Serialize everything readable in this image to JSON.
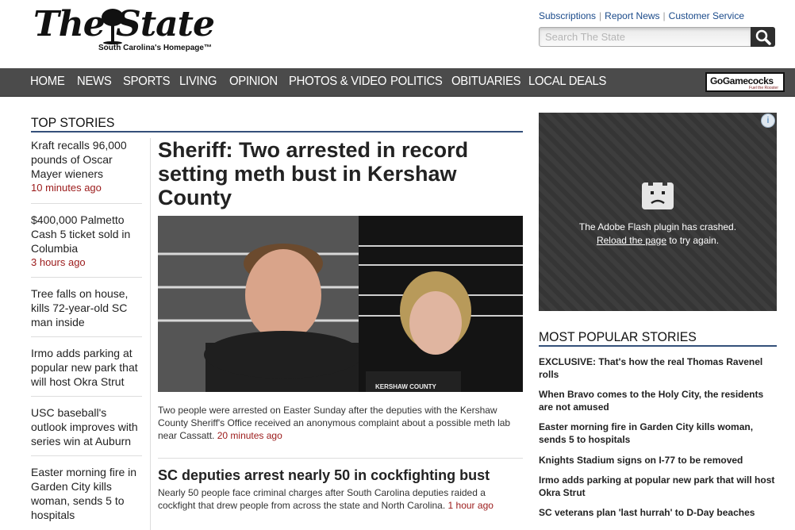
{
  "header": {
    "logo_text": "The State",
    "tagline": "South Carolina's Homepage™",
    "links": [
      "Subscriptions",
      "Report News",
      "Customer Service"
    ],
    "search_placeholder": "Search The State"
  },
  "nav": {
    "items": [
      "HOME",
      "NEWS",
      "SPORTS",
      "LIVING",
      "OPINION",
      "PHOTOS & VIDEO",
      "POLITICS",
      "OBITUARIES",
      "LOCAL DEALS"
    ],
    "promo": "GoGamecocks",
    "promo_sub": "Fuel the Rooster"
  },
  "top_stories": {
    "title": "TOP STORIES",
    "items": [
      {
        "title": "Kraft recalls 96,000 pounds of Oscar Mayer wieners",
        "time": "10 minutes ago"
      },
      {
        "title": "$400,000 Palmetto Cash 5 ticket sold in Columbia",
        "time": "3 hours ago"
      },
      {
        "title": "Tree falls on house, kills 72-year-old SC man inside",
        "time": ""
      },
      {
        "title": "Irmo adds parking at popular new park that will host Okra Strut",
        "time": ""
      },
      {
        "title": "USC baseball's outlook improves with series win at Auburn",
        "time": ""
      },
      {
        "title": "Easter morning fire in Garden City kills woman, sends 5 to hospitals",
        "time": ""
      }
    ]
  },
  "main": {
    "headline": "Sheriff: Two arrested in record setting meth bust in Kershaw County",
    "photo_caption": "KERSHAW COUNTY",
    "summary": "Two people were arrested on Easter Sunday after the deputies with the Kershaw County Sheriff's Office received an anonymous complaint about a possible meth lab near Cassatt.",
    "summary_time": "20 minutes ago",
    "headline2": "SC deputies arrest nearly 50 in cockfighting bust",
    "summary2": "Nearly 50 people face criminal charges after South Carolina deputies raided a cockfight that drew people from across the state and North Carolina.",
    "summary2_time": "1 hour ago"
  },
  "ad": {
    "badge": "i",
    "message": "The Adobe Flash plugin has crashed.",
    "reload_link": "Reload the page",
    "reload_suffix": " to try again."
  },
  "most_popular": {
    "title": "MOST POPULAR STORIES",
    "items": [
      "EXCLUSIVE: That's how the real Thomas Ravenel rolls",
      "When Bravo comes to the Holy City, the residents are not amused",
      "Easter morning fire in Garden City kills woman, sends 5 to hospitals",
      "Knights Stadium signs on I-77 to be removed",
      "Irmo adds parking at popular new park that will host Okra Strut",
      "SC veterans plan 'last hurrah' to D-Day beaches"
    ]
  }
}
